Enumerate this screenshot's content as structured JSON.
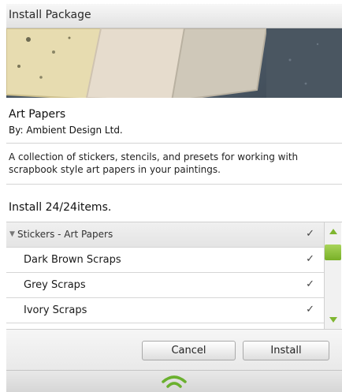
{
  "window": {
    "title": "Install Package"
  },
  "package": {
    "name": "Art Papers",
    "author": "By: Ambient Design Ltd.",
    "description": "A collection of stickers, stencils, and presets for working with scrapbook style art papers in your paintings."
  },
  "install": {
    "count_text": "Install 24/24items."
  },
  "items": {
    "group": {
      "label": "Stickers - Art Papers",
      "check": "✓"
    },
    "rows": [
      {
        "label": "Dark Brown Scraps",
        "check": "✓"
      },
      {
        "label": "Grey Scraps",
        "check": "✓"
      },
      {
        "label": "Ivory Scraps",
        "check": "✓"
      }
    ]
  },
  "buttons": {
    "cancel": "Cancel",
    "install": "Install"
  },
  "colors": {
    "accent": "#7fb630",
    "activity": "#6ab02e"
  },
  "icons": {
    "group_toggle": "triangle-down-icon",
    "check": "checkmark-icon",
    "status": "wifi-activity-icon"
  }
}
